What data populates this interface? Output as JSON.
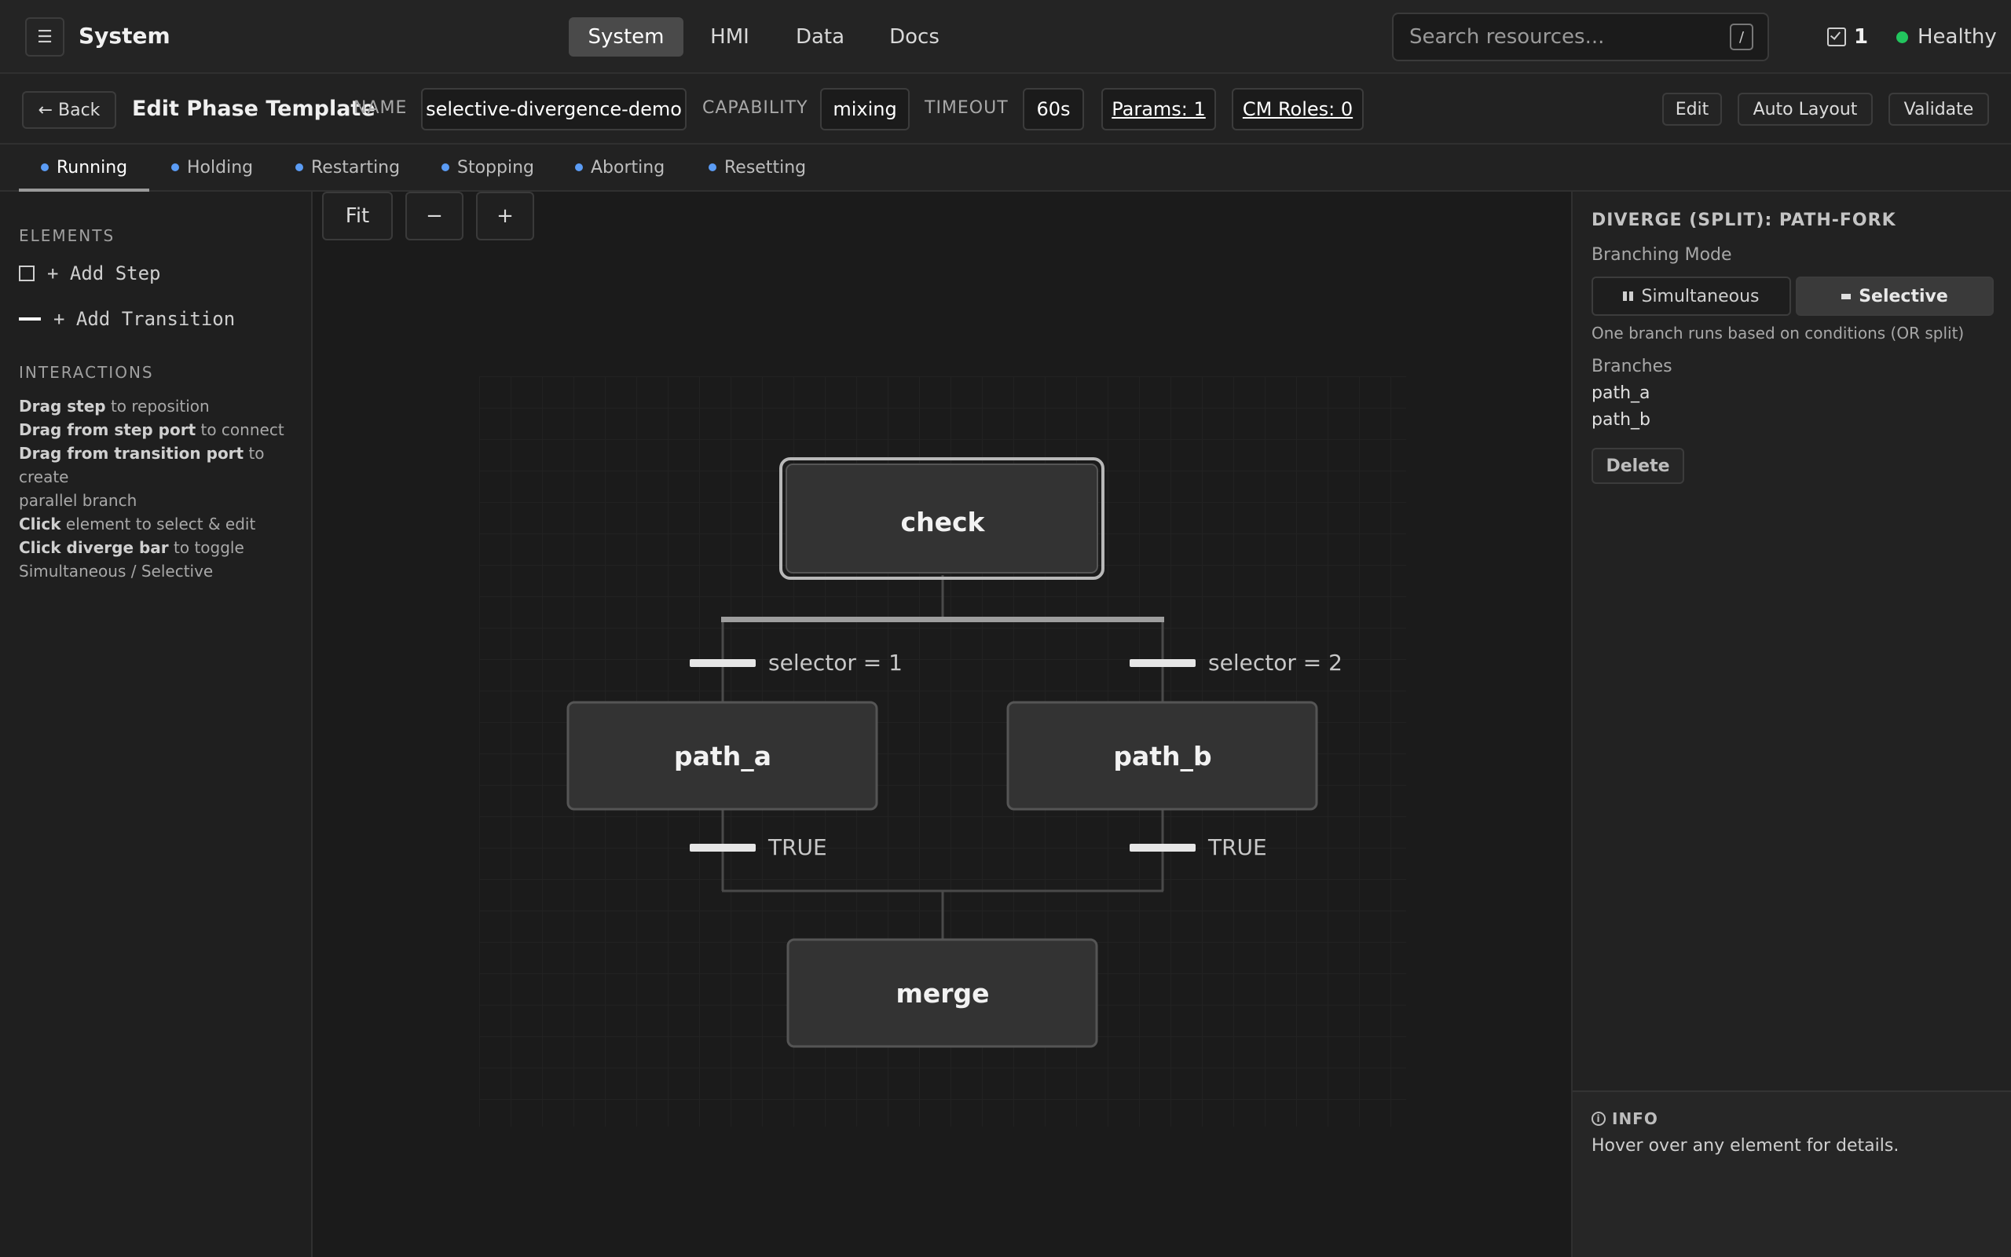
{
  "app": {
    "title": "System",
    "menu_icon": "☰"
  },
  "nav": {
    "tabs": [
      "System",
      "HMI",
      "Data",
      "Docs"
    ],
    "active": "System"
  },
  "search": {
    "placeholder": "Search resources...",
    "shortcut": "/"
  },
  "tasks": {
    "count": "1"
  },
  "health": {
    "label": "Healthy",
    "color": "#22c55e"
  },
  "editbar": {
    "back_label": "← Back",
    "title": "Edit Phase Template",
    "name_label": "NAME",
    "name_value": "selective-divergence-demo",
    "capability_label": "CAPABILITY",
    "capability_value": "mixing",
    "timeout_label": "TIMEOUT",
    "timeout_value": "60s",
    "params_label": "Params: 1",
    "cm_roles_label": "CM Roles: 0",
    "edit_label": "Edit",
    "auto_layout_label": "Auto Layout",
    "validate_label": "Validate"
  },
  "state_tabs": [
    "Running",
    "Holding",
    "Restarting",
    "Stopping",
    "Aborting",
    "Resetting"
  ],
  "state_tab_active": "Running",
  "sidebar": {
    "elements_title": "ELEMENTS",
    "add_step": "+ Add Step",
    "add_transition": "+ Add Transition",
    "interactions_title": "INTERACTIONS",
    "help": [
      {
        "bold": "Drag step",
        "rest": " to reposition"
      },
      {
        "bold": "Drag from step port",
        "rest": " to connect"
      },
      {
        "bold": "Drag from transition port",
        "rest": " to create"
      },
      {
        "bold": "",
        "rest": "parallel branch"
      },
      {
        "bold": "Click",
        "rest": " element to select & edit"
      },
      {
        "bold": "Click diverge bar",
        "rest": " to toggle"
      },
      {
        "bold": "",
        "rest": "Simultaneous / Selective"
      }
    ]
  },
  "canvas": {
    "zoom_fit": "Fit",
    "zoom_out": "−",
    "zoom_in": "+",
    "steps": {
      "check": "check",
      "path_a": "path_a",
      "path_b": "path_b",
      "merge": "merge"
    },
    "transitions": {
      "t_a": "selector = 1",
      "t_b": "selector = 2",
      "t_a_out": "TRUE",
      "t_b_out": "TRUE"
    }
  },
  "panel": {
    "title": "DIVERGE (SPLIT): PATH-FORK",
    "branching_label": "Branching Mode",
    "mode_simultaneous": "Simultaneous",
    "mode_selective": "Selective",
    "mode_active": "Selective",
    "mode_description": "One branch runs based on conditions (OR split)",
    "branches_label": "Branches",
    "branches": [
      "path_a",
      "path_b"
    ],
    "delete_label": "Delete",
    "info_title": "INFO",
    "info_text": "Hover over any element for details."
  }
}
